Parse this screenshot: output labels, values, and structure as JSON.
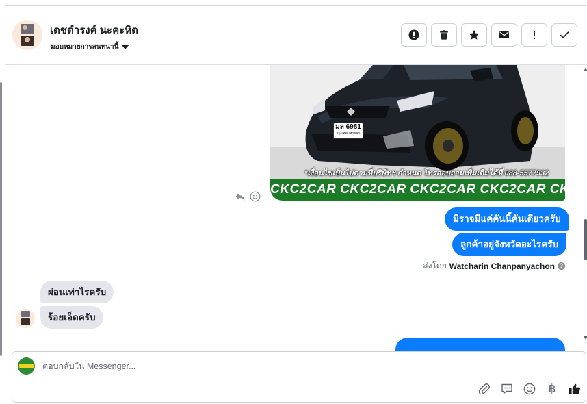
{
  "header": {
    "contact_name": "เดชดำรงค์ นะคะหิต",
    "assign_label": "มอบหมายการสนทนานี้",
    "actions": [
      {
        "name": "spam-button",
        "icon": "exclamation-circle-icon"
      },
      {
        "name": "delete-button",
        "icon": "trash-icon"
      },
      {
        "name": "star-button",
        "icon": "star-icon"
      },
      {
        "name": "mark-unread-button",
        "icon": "envelope-icon"
      },
      {
        "name": "follow-up-button",
        "icon": "exclamation-icon",
        "label": "!"
      },
      {
        "name": "mark-done-button",
        "icon": "checkmark-icon"
      }
    ]
  },
  "conversation": {
    "image_message": {
      "caption": "*เงื่อนไขเป็นไปตามที่บริษัทฯ กำหนด โทรสอบถามเพิ่มเติมได้ที่ 088-5577932",
      "band_text": "CKC2CAR CKC2CAR CKC2CAR CKC2CAR CKC2",
      "plate_main": "มล 6981",
      "plate_sub": "กรุงเทพมหานคร"
    },
    "outgoing": [
      "มิราจมีแค่คันนี้คันเดียวครับ",
      "ลูกค้าอยู่จังหวัดอะไรครับ"
    ],
    "sent_by_label": "ส่งโดย",
    "sent_by_name": "Watcharin Chanpanyachon",
    "help_glyph": "?",
    "incoming": [
      "ผ่อนเท่าไรครับ",
      "ร้อยเอ็ดครับ"
    ]
  },
  "composer": {
    "placeholder": "ตอบกลับใน Messenger...",
    "tools": [
      "paperclip-icon",
      "saved-replies-icon",
      "emoji-icon",
      "baht-icon",
      "thumbs-up-icon"
    ],
    "baht_glyph": "฿"
  },
  "colors": {
    "accent": "#0a7cff",
    "incoming_bubble": "#e4e6eb",
    "band_green": "#1b7b26"
  }
}
